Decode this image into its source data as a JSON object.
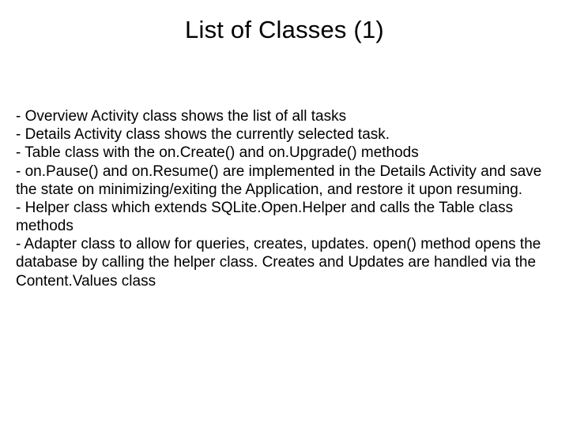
{
  "title": "List of Classes (1)",
  "lines": {
    "l0": "- Overview Activity class shows the list of all tasks",
    "l1": "- Details Activity class shows the currently selected task.",
    "l2": "- Table class with the on.Create() and on.Upgrade() methods",
    "l3": "- on.Pause() and on.Resume() are implemented in the Details Activity and save the state on minimizing/exiting the Application, and restore it upon resuming.",
    "l4": "- Helper class which extends SQLite.Open.Helper and calls the Table class methods",
    "l5": "- Adapter class to allow for queries, creates, updates.  open() method opens the database by calling the helper class.  Creates and Updates are handled via the Content.Values class"
  }
}
